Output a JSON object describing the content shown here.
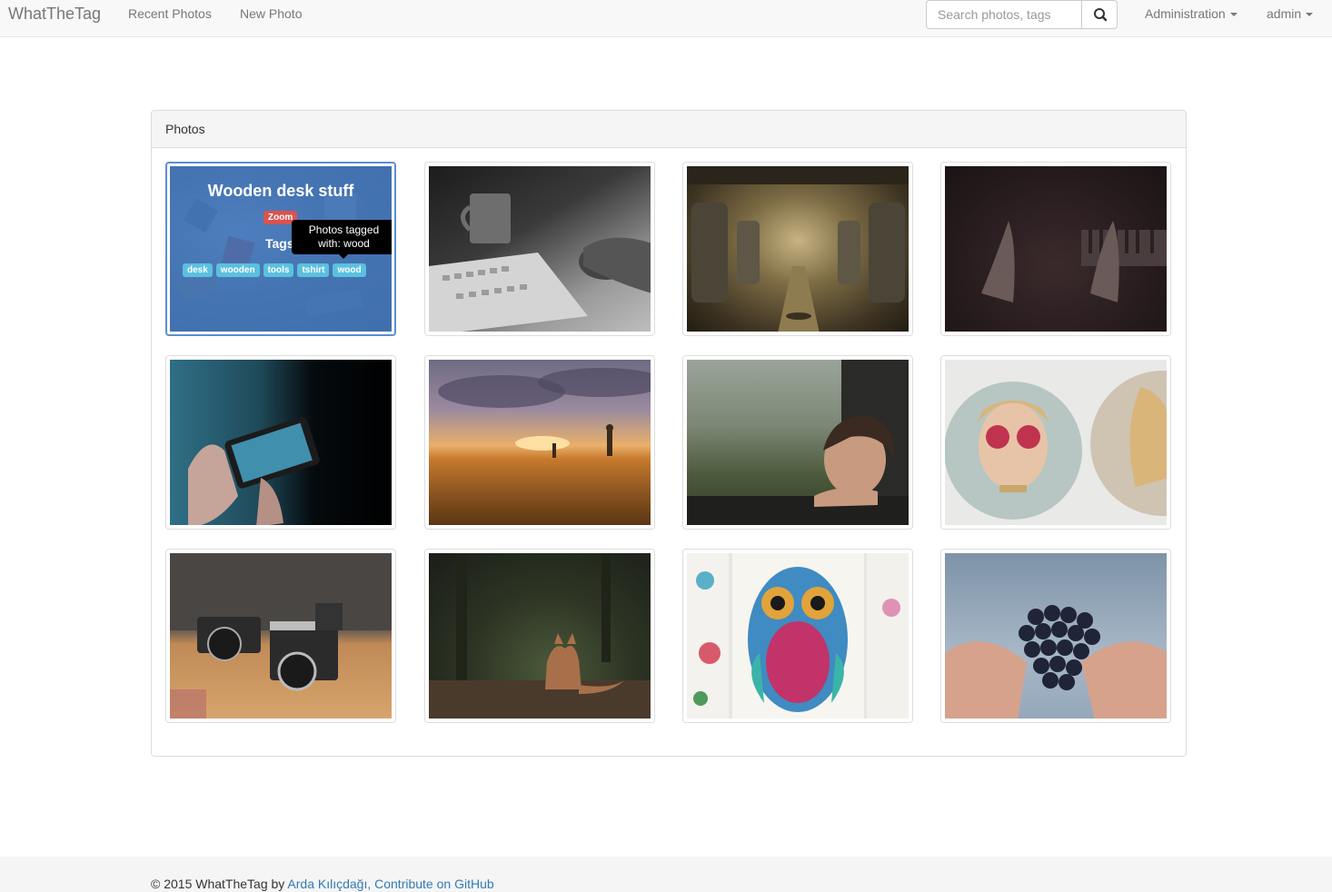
{
  "navbar": {
    "brand": "WhatTheTag",
    "links": [
      "Recent Photos",
      "New Photo"
    ],
    "search_placeholder": "Search photos, tags",
    "admin_menu": "Administration",
    "user_menu": "admin"
  },
  "panel": {
    "heading": "Photos",
    "photos": [
      {
        "name": "photo-wooden-desk",
        "subject": "wooden desk with tools and stamps"
      },
      {
        "name": "photo-keyboard-mug",
        "subject": "keyboard, mouse and mug black and white"
      },
      {
        "name": "photo-tram-interior",
        "subject": "tram interior seats"
      },
      {
        "name": "photo-piano-hands",
        "subject": "hands on dark piano"
      },
      {
        "name": "photo-phone-hands",
        "subject": "hands holding phone"
      },
      {
        "name": "photo-field-sunset",
        "subject": "golden field at sunset"
      },
      {
        "name": "photo-boy-window",
        "subject": "boy looking out rainy train window"
      },
      {
        "name": "photo-woman-sunglasses",
        "subject": "woman with heart sunglasses"
      },
      {
        "name": "photo-vintage-cameras",
        "subject": "vintage cameras on shelf"
      },
      {
        "name": "photo-fox-forest",
        "subject": "fox in dark forest"
      },
      {
        "name": "photo-owl-coloring",
        "subject": "colorful owl drawing"
      },
      {
        "name": "photo-grapes-hands",
        "subject": "hands holding grapes"
      }
    ],
    "hover_card": {
      "title": "Wooden desk stuff",
      "zoom_label": "Zoom",
      "tags_label": "Tags",
      "tags": [
        "desk",
        "wooden",
        "tools",
        "tshirt",
        "wood"
      ],
      "tooltip": "Photos tagged with: wood"
    }
  },
  "footer": {
    "copyright": "© 2015 WhatTheTag by ",
    "author_link": "Arda Kılıçdağı",
    "separator": ", ",
    "github_link": "Contribute on GitHub"
  },
  "colors": {
    "overlay": "#427ac4",
    "zoom_badge": "#d9534f",
    "tag": "#5bc0de",
    "link": "#337ab7"
  }
}
